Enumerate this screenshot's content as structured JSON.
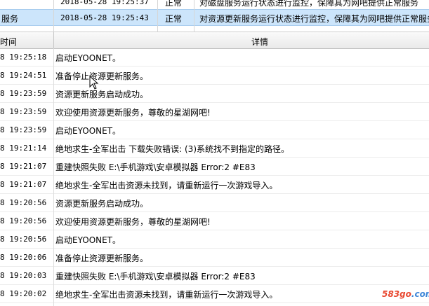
{
  "upper_rows": [
    {
      "name": "",
      "time": "2018-05-28 19:25:37",
      "status": "正常",
      "detail": "对磁盘服务运行状态进行监控，保障其为网吧提供正常服务"
    },
    {
      "name": "服务",
      "time": "2018-05-28 19:25:43",
      "status": "正常",
      "detail": "对资源更新服务运行状态进行监控，保障其为网吧提供正常服务"
    }
  ],
  "header": {
    "time_label": "时间",
    "detail_label": "详情"
  },
  "log_rows": [
    {
      "time": "8 19:25:18",
      "detail": "启动EYOONET。"
    },
    {
      "time": "8 19:24:51",
      "detail": "准备停止资源更新服务。"
    },
    {
      "time": "8 19:23:59",
      "detail": "资源更新服务启动成功。"
    },
    {
      "time": "8 19:23:59",
      "detail": "欢迎使用资源更新服务，尊敬的星湖网吧!"
    },
    {
      "time": "8 19:23:59",
      "detail": "启动EYOONET。"
    },
    {
      "time": "8 19:21:14",
      "detail": "绝地求生-全军出击 下载失败错误: (3)系统找不到指定的路径。"
    },
    {
      "time": "8 19:21:07",
      "detail": "重建快照失败 E:\\手机游戏\\安卓模拟器  Error:2 #E83"
    },
    {
      "time": "8 19:21:07",
      "detail": "绝地求生-全军出击资源未找到，请重新运行一次游戏导入。"
    },
    {
      "time": "8 19:20:56",
      "detail": "资源更新服务启动成功。"
    },
    {
      "time": "8 19:20:56",
      "detail": "欢迎使用资源更新服务，尊敬的星湖网吧!"
    },
    {
      "time": "8 19:20:56",
      "detail": "启动EYOONET。"
    },
    {
      "time": "8 19:20:06",
      "detail": "准备停止资源更新服务。"
    },
    {
      "time": "8 19:20:03",
      "detail": "重建快照失败 E:\\手机游戏\\安卓模拟器  Error:2 #E83"
    },
    {
      "time": "8 19:20:02",
      "detail": "绝地求生-全军出击资源未找到，请重新运行一次游戏导入。"
    }
  ],
  "watermark": {
    "left": "583go",
    "right": ".com"
  },
  "icons": {
    "cursor": "mouse-pointer-icon"
  }
}
